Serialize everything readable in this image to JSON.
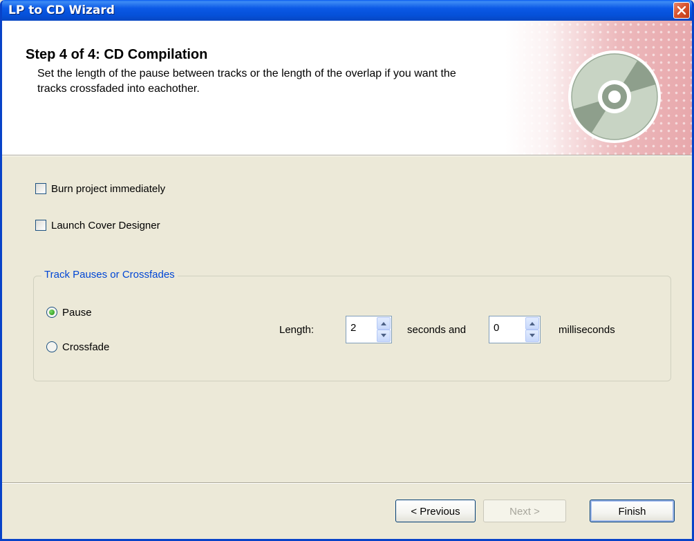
{
  "window": {
    "title": "LP to CD Wizard"
  },
  "header": {
    "title": "Step 4 of 4: CD Compilation",
    "description": "Set the length of the pause between tracks or the length of the overlap if you want the tracks crossfaded into eachother."
  },
  "options": {
    "burn_immediately": {
      "label": "Burn project immediately",
      "checked": false
    },
    "launch_cover_designer": {
      "label": "Launch Cover Designer",
      "checked": false
    }
  },
  "track_group": {
    "title": "Track Pauses or Crossfades",
    "pause_label": "Pause",
    "crossfade_label": "Crossfade",
    "selected": "Pause",
    "length_label": "Length:",
    "seconds_value": "2",
    "seconds_label": "seconds and",
    "milliseconds_value": "0",
    "milliseconds_label": "milliseconds"
  },
  "buttons": {
    "previous": "< Previous",
    "next": "Next >",
    "finish": "Finish"
  },
  "colors": {
    "titlebar": "#0b59e6",
    "group_title": "#0046d5",
    "dialog_bg": "#ece9d8"
  },
  "icons": {
    "close": "close-icon",
    "cd": "cd-disc-icon"
  }
}
